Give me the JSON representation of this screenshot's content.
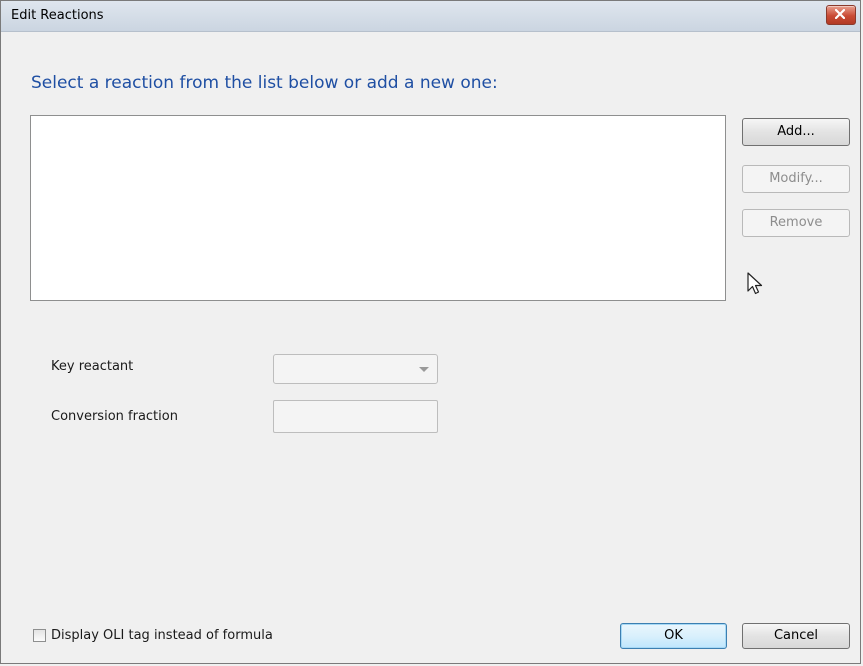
{
  "window": {
    "title": "Edit Reactions"
  },
  "heading": "Select a reaction from the list below or add a new one:",
  "reactions_list": [],
  "buttons": {
    "add": "Add...",
    "modify": "Modify...",
    "remove": "Remove",
    "ok": "OK",
    "cancel": "Cancel"
  },
  "fields": {
    "key_reactant_label": "Key reactant",
    "key_reactant_value": "",
    "conversion_fraction_label": "Conversion fraction",
    "conversion_fraction_value": ""
  },
  "options": {
    "display_oli_tag_label": "Display OLI tag instead of formula",
    "display_oli_tag_checked": false
  },
  "colors": {
    "heading": "#1f4fa3",
    "close_button": "#c94b35"
  }
}
